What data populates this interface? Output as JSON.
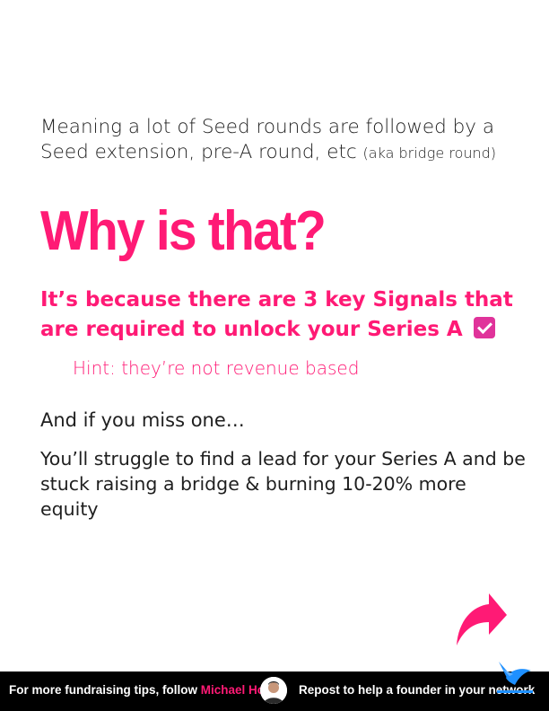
{
  "intro": {
    "text": "Meaning a lot of Seed rounds are followed by a Seed extension, pre-A round, etc",
    "aside": "(aka bridge round)"
  },
  "heading": "Why is that?",
  "subheading": "It’s because there are 3 key Signals that are required to unlock your Series A",
  "hint": "Hint: they’re not revenue based",
  "line1": "And if you miss one…",
  "line2": "You’ll struggle to find a lead for your Series A and be stuck raising a bridge & burning 10-20% more equity",
  "footer": {
    "left_prefix": "For more fundraising tips, follow",
    "author": "Michael Ho",
    "right": "Repost to help a founder in your network"
  },
  "icons": {
    "check": "checkbox-checked-icon",
    "arrow": "share-arrow-icon",
    "avatar": "author-avatar",
    "logo": "bird-logo-icon"
  },
  "colors": {
    "accent": "#ff1a75",
    "footer_bg": "#000000"
  }
}
